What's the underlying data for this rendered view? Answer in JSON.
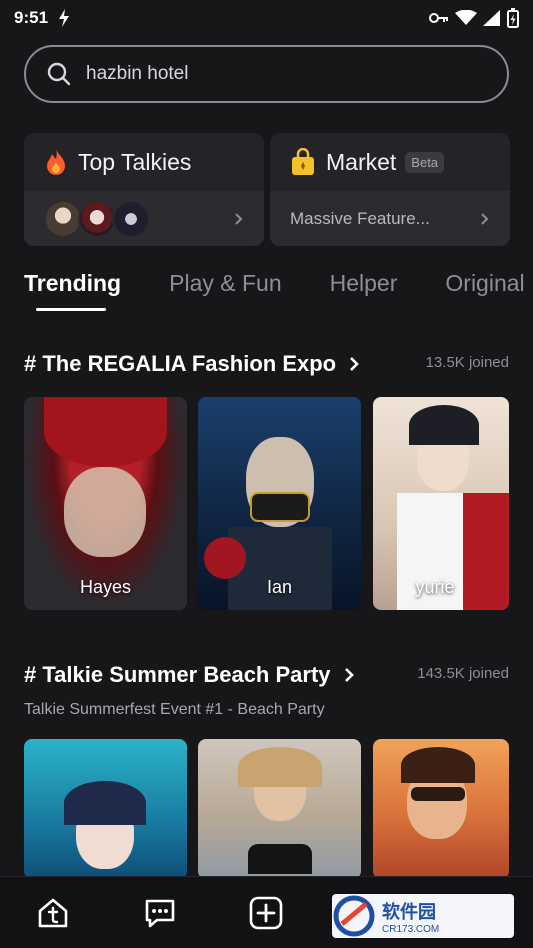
{
  "status": {
    "time": "9:51"
  },
  "search": {
    "query": "hazbin hotel"
  },
  "cards": [
    {
      "title": "Top Talkies",
      "icon": "fire-icon"
    },
    {
      "title": "Market",
      "badge": "Beta",
      "subtitle": "Massive Feature...",
      "icon": "shopping-bag-icon"
    }
  ],
  "tabs": [
    "Trending",
    "Play & Fun",
    "Helper",
    "Original"
  ],
  "active_tab": "Trending",
  "sections": [
    {
      "title": "# The REGALIA Fashion Expo",
      "joined": "13.5K joined",
      "characters": [
        "Hayes",
        "Ian",
        "yurie"
      ]
    },
    {
      "title": "# Talkie Summer Beach Party",
      "joined": "143.5K joined",
      "subtitle": "Talkie Summerfest Event #1 - Beach Party"
    }
  ],
  "bottom_nav": [
    "home-icon",
    "chat-icon",
    "create-icon",
    "profile-icon"
  ],
  "watermark": {
    "text": "软件园",
    "sub": "CR173.COM"
  },
  "colors": {
    "background": "#17171a",
    "card": "#242428",
    "accent": "#ffffff",
    "muted": "#8e8e93"
  }
}
